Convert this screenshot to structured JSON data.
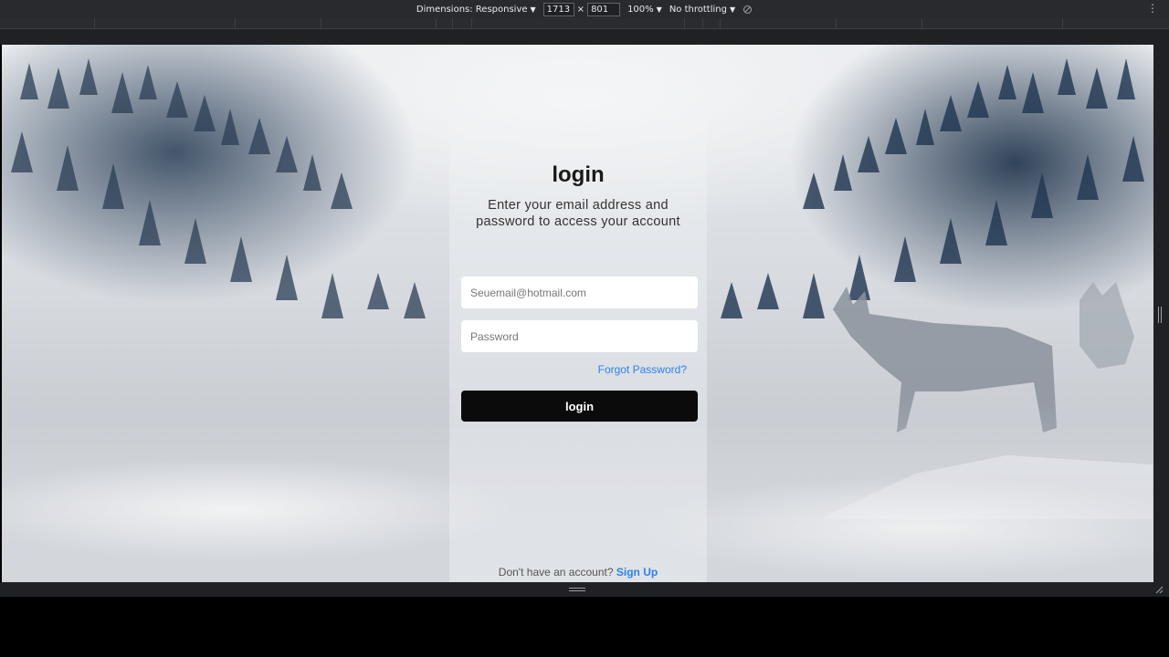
{
  "devtools": {
    "dimensions_label": "Dimensions: Responsive",
    "width_value": "1713",
    "times": "×",
    "height_value": "801",
    "zoom": "100%",
    "throttling": "No throttling",
    "rotate_icon": "rotate-icon",
    "menu_icon": "more-vert-icon"
  },
  "login": {
    "title": "login",
    "subtitle": "Enter your email address and password to access your account",
    "email_placeholder": "Seuemail@hotmail.com",
    "password_placeholder": "Password",
    "forgot_label": "Forgot Password?",
    "button_label": "login",
    "no_account_text": "Don't have an account?",
    "signup_label": "Sign Up"
  },
  "colors": {
    "accent": "#2f80ed",
    "button": "#0b0b0b",
    "devtools_bg": "#292a2d"
  }
}
